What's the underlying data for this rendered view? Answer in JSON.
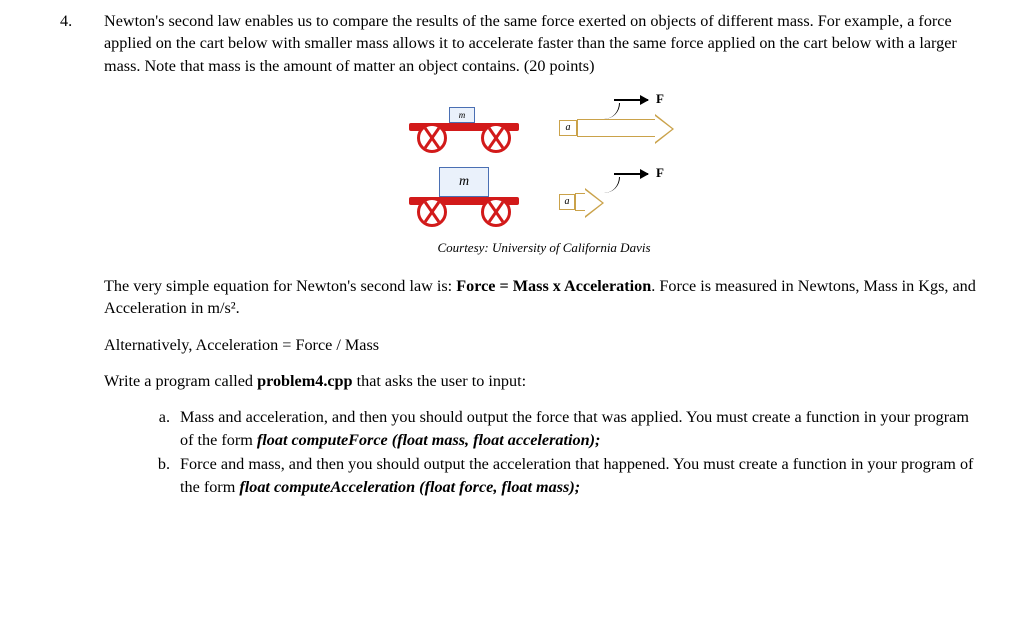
{
  "question": {
    "number": "4.",
    "intro": "Newton's second law enables us to compare the results of the same force exerted on objects of different mass. For example, a force applied on the cart below with smaller mass allows it to accelerate faster than the same force applied on the cart below with a larger mass. Note that mass is the amount of matter an object contains. (20 points)"
  },
  "illustration": {
    "small_cart_mass_label": "m",
    "big_cart_mass_label": "m",
    "force_label": "F",
    "accel_label_big": "a",
    "accel_label_small": "a",
    "credit": "Courtesy: University of California Davis"
  },
  "body": {
    "eqn_intro_prefix": "The very simple equation for Newton's second law is: ",
    "eqn_bold": "Force = Mass x Acceleration",
    "eqn_intro_suffix": ". Force is measured in Newtons, Mass in Kgs, and Acceleration in m/s².",
    "alt": "Alternatively, Acceleration = Force / Mass",
    "write_prefix": "Write a program called ",
    "write_filename": "problem4.cpp",
    "write_suffix": " that asks the user to input:"
  },
  "subparts": {
    "a": {
      "letter": "a.",
      "text_prefix": "Mass and acceleration, and then you should output the force that was applied. You must create a function in your program of the form ",
      "signature": "float computeForce (float mass, float acceleration);"
    },
    "b": {
      "letter": "b.",
      "text_prefix": "Force and mass, and then you should output the acceleration that happened. You must create a function in your program of the form ",
      "signature": "float computeAcceleration (float force, float mass);"
    }
  }
}
